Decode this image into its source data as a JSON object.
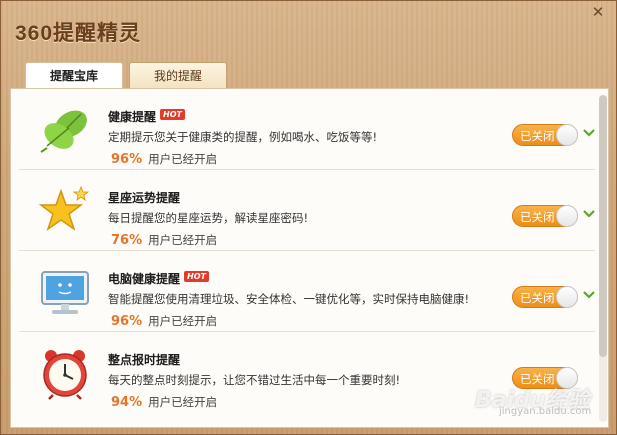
{
  "window": {
    "title": "360提醒精灵",
    "close_glyph": "✕"
  },
  "tabs": [
    {
      "label": "提醒宝库",
      "active": true
    },
    {
      "label": "我的提醒",
      "active": false
    }
  ],
  "items": [
    {
      "icon": "leaf-icon",
      "title": "健康提醒",
      "hot": "HOT",
      "desc": "定期提示您关于健康类的提醒，例如喝水、吃饭等等!",
      "pct": "96%",
      "stat": "用户已经开启",
      "toggle": "已关闭"
    },
    {
      "icon": "star-icon",
      "title": "星座运势提醒",
      "hot": "",
      "desc": "每日提醒您的星座运势，解读星座密码!",
      "pct": "76%",
      "stat": "用户已经开启",
      "toggle": "已关闭"
    },
    {
      "icon": "monitor-icon",
      "title": "电脑健康提醒",
      "hot": "HOT",
      "desc": "智能提醒您使用清理垃圾、安全体检、一键优化等，实时保持电脑健康!",
      "pct": "96%",
      "stat": "用户已经开启",
      "toggle": "已关闭"
    },
    {
      "icon": "alarm-clock-icon",
      "title": "整点报时提醒",
      "hot": "",
      "desc": "每天的整点时刻提示，让您不错过生活中每一个重要时刻!",
      "pct": "94%",
      "stat": "用户已经开启",
      "toggle": "已关闭"
    }
  ],
  "watermark": {
    "text": "Baidu经验",
    "sub": "jingyan.baidu.com"
  },
  "colors": {
    "accent_orange": "#ec8e18",
    "expand_green": "#5aa52c",
    "pct_orange": "#e3752a",
    "hot_red": "#e23b2a"
  }
}
